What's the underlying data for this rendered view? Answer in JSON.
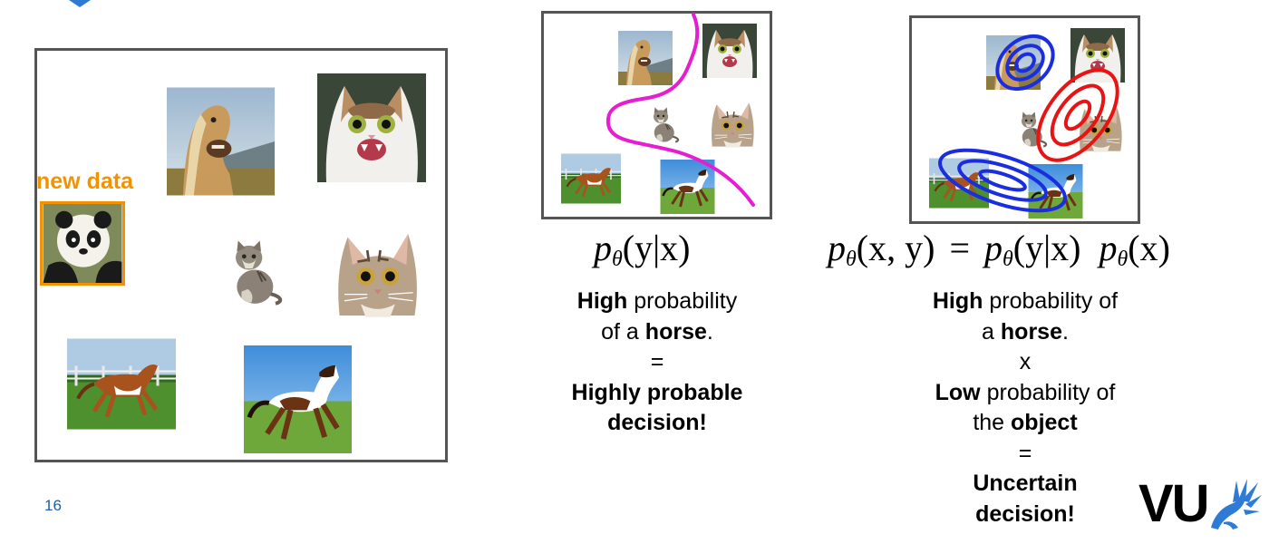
{
  "slide": {
    "page_number": "16",
    "new_data_label": "new data"
  },
  "discriminative": {
    "formula": {
      "p": "p",
      "sub": "θ",
      "args": "(y|x)"
    },
    "explanation": {
      "line1_bold": "High",
      "line1_rest": " probability",
      "line2_pre": "of a ",
      "line2_bold": "horse",
      "line2_post": ".",
      "eq": "=",
      "line3_bold": "Highly probable",
      "line4_bold": "decision!"
    }
  },
  "generative": {
    "formula": {
      "p1": "p",
      "sub1": "θ",
      "args1": "(x, y)",
      "eq": "=",
      "p2": "p",
      "sub2": "θ",
      "args2": "(y|x)",
      "p3": "p",
      "sub3": "θ",
      "args3": "(x)"
    },
    "explanation": {
      "l1_bold": "High",
      "l1_rest": " probability of",
      "l2_pre": "a ",
      "l2_bold": "horse",
      "l2_post": ".",
      "times": "x",
      "l3_bold": "Low",
      "l3_rest": " probability of",
      "l4_pre": "the ",
      "l4_bold": "object",
      "eq": "=",
      "l5_bold": "Uncertain",
      "l6_bold": "decision!"
    }
  },
  "logo": {
    "text": "VU"
  },
  "colors": {
    "new_data": "#F39200",
    "boundary": "#E61ED2",
    "horse_density": "#1A2EE0",
    "cat_density": "#E81414",
    "frame": "#555555",
    "page_number": "#1F5BA6"
  }
}
